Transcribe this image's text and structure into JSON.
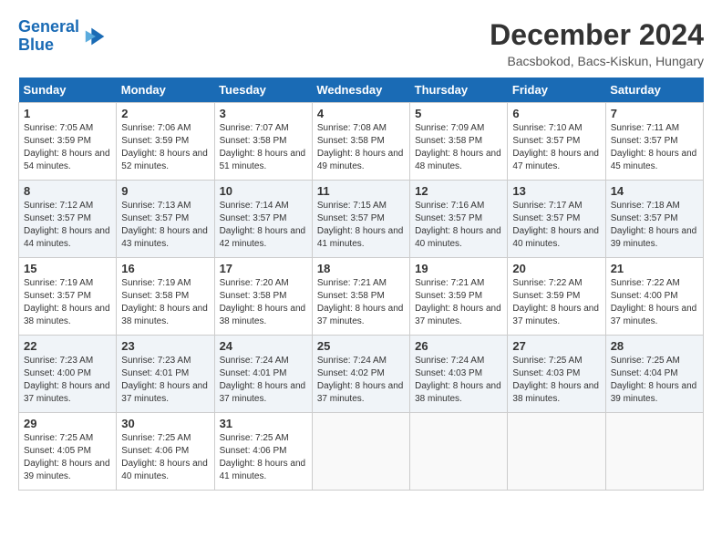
{
  "logo": {
    "line1": "General",
    "line2": "Blue"
  },
  "title": "December 2024",
  "location": "Bacsbokod, Bacs-Kiskun, Hungary",
  "days_of_week": [
    "Sunday",
    "Monday",
    "Tuesday",
    "Wednesday",
    "Thursday",
    "Friday",
    "Saturday"
  ],
  "weeks": [
    [
      {
        "day": "1",
        "sunrise": "7:05 AM",
        "sunset": "3:59 PM",
        "daylight": "8 hours and 54 minutes."
      },
      {
        "day": "2",
        "sunrise": "7:06 AM",
        "sunset": "3:59 PM",
        "daylight": "8 hours and 52 minutes."
      },
      {
        "day": "3",
        "sunrise": "7:07 AM",
        "sunset": "3:58 PM",
        "daylight": "8 hours and 51 minutes."
      },
      {
        "day": "4",
        "sunrise": "7:08 AM",
        "sunset": "3:58 PM",
        "daylight": "8 hours and 49 minutes."
      },
      {
        "day": "5",
        "sunrise": "7:09 AM",
        "sunset": "3:58 PM",
        "daylight": "8 hours and 48 minutes."
      },
      {
        "day": "6",
        "sunrise": "7:10 AM",
        "sunset": "3:57 PM",
        "daylight": "8 hours and 47 minutes."
      },
      {
        "day": "7",
        "sunrise": "7:11 AM",
        "sunset": "3:57 PM",
        "daylight": "8 hours and 45 minutes."
      }
    ],
    [
      {
        "day": "8",
        "sunrise": "7:12 AM",
        "sunset": "3:57 PM",
        "daylight": "8 hours and 44 minutes."
      },
      {
        "day": "9",
        "sunrise": "7:13 AM",
        "sunset": "3:57 PM",
        "daylight": "8 hours and 43 minutes."
      },
      {
        "day": "10",
        "sunrise": "7:14 AM",
        "sunset": "3:57 PM",
        "daylight": "8 hours and 42 minutes."
      },
      {
        "day": "11",
        "sunrise": "7:15 AM",
        "sunset": "3:57 PM",
        "daylight": "8 hours and 41 minutes."
      },
      {
        "day": "12",
        "sunrise": "7:16 AM",
        "sunset": "3:57 PM",
        "daylight": "8 hours and 40 minutes."
      },
      {
        "day": "13",
        "sunrise": "7:17 AM",
        "sunset": "3:57 PM",
        "daylight": "8 hours and 40 minutes."
      },
      {
        "day": "14",
        "sunrise": "7:18 AM",
        "sunset": "3:57 PM",
        "daylight": "8 hours and 39 minutes."
      }
    ],
    [
      {
        "day": "15",
        "sunrise": "7:19 AM",
        "sunset": "3:57 PM",
        "daylight": "8 hours and 38 minutes."
      },
      {
        "day": "16",
        "sunrise": "7:19 AM",
        "sunset": "3:58 PM",
        "daylight": "8 hours and 38 minutes."
      },
      {
        "day": "17",
        "sunrise": "7:20 AM",
        "sunset": "3:58 PM",
        "daylight": "8 hours and 38 minutes."
      },
      {
        "day": "18",
        "sunrise": "7:21 AM",
        "sunset": "3:58 PM",
        "daylight": "8 hours and 37 minutes."
      },
      {
        "day": "19",
        "sunrise": "7:21 AM",
        "sunset": "3:59 PM",
        "daylight": "8 hours and 37 minutes."
      },
      {
        "day": "20",
        "sunrise": "7:22 AM",
        "sunset": "3:59 PM",
        "daylight": "8 hours and 37 minutes."
      },
      {
        "day": "21",
        "sunrise": "7:22 AM",
        "sunset": "4:00 PM",
        "daylight": "8 hours and 37 minutes."
      }
    ],
    [
      {
        "day": "22",
        "sunrise": "7:23 AM",
        "sunset": "4:00 PM",
        "daylight": "8 hours and 37 minutes."
      },
      {
        "day": "23",
        "sunrise": "7:23 AM",
        "sunset": "4:01 PM",
        "daylight": "8 hours and 37 minutes."
      },
      {
        "day": "24",
        "sunrise": "7:24 AM",
        "sunset": "4:01 PM",
        "daylight": "8 hours and 37 minutes."
      },
      {
        "day": "25",
        "sunrise": "7:24 AM",
        "sunset": "4:02 PM",
        "daylight": "8 hours and 37 minutes."
      },
      {
        "day": "26",
        "sunrise": "7:24 AM",
        "sunset": "4:03 PM",
        "daylight": "8 hours and 38 minutes."
      },
      {
        "day": "27",
        "sunrise": "7:25 AM",
        "sunset": "4:03 PM",
        "daylight": "8 hours and 38 minutes."
      },
      {
        "day": "28",
        "sunrise": "7:25 AM",
        "sunset": "4:04 PM",
        "daylight": "8 hours and 39 minutes."
      }
    ],
    [
      {
        "day": "29",
        "sunrise": "7:25 AM",
        "sunset": "4:05 PM",
        "daylight": "8 hours and 39 minutes."
      },
      {
        "day": "30",
        "sunrise": "7:25 AM",
        "sunset": "4:06 PM",
        "daylight": "8 hours and 40 minutes."
      },
      {
        "day": "31",
        "sunrise": "7:25 AM",
        "sunset": "4:06 PM",
        "daylight": "8 hours and 41 minutes."
      },
      null,
      null,
      null,
      null
    ]
  ],
  "labels": {
    "sunrise": "Sunrise:",
    "sunset": "Sunset:",
    "daylight": "Daylight:"
  }
}
